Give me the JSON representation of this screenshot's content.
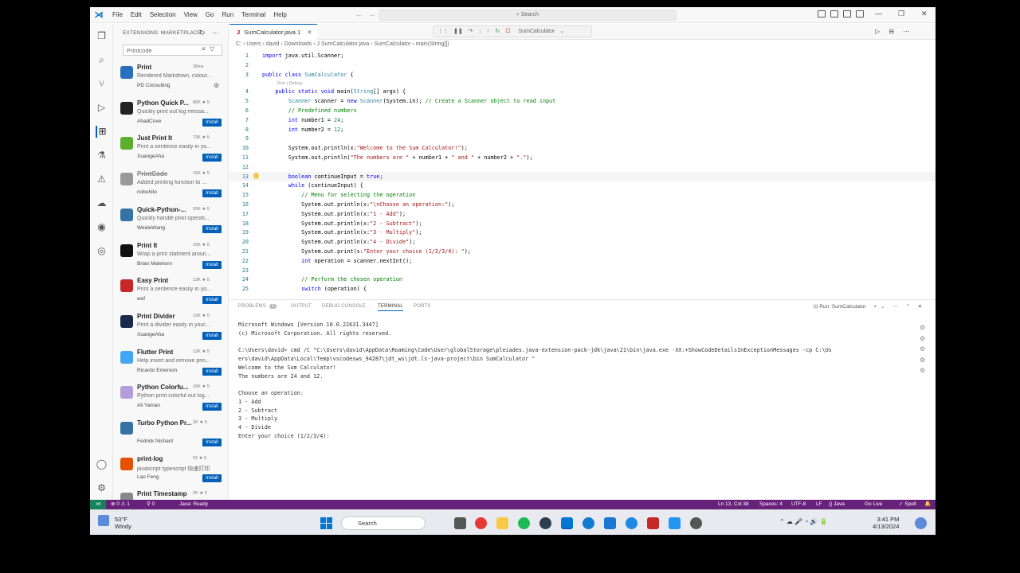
{
  "menu": [
    "File",
    "Edit",
    "Selection",
    "View",
    "Go",
    "Run",
    "Terminal",
    "Help"
  ],
  "command_center": "Search",
  "sidebar": {
    "title": "EXTENSIONS: MARKETPLACE",
    "search_value": "Printcode",
    "extensions": [
      {
        "name": "Print",
        "stats": "38ms",
        "desc": "Rendered Markdown, colour...",
        "publisher": "PD Consulting",
        "action": "gear",
        "color": "#2a6fbf"
      },
      {
        "name": "Python Quick P...",
        "stats": "80K ★ 5",
        "desc": "Quickly print out log messa...",
        "publisher": "AhadCove",
        "action": "Install",
        "color": "#222"
      },
      {
        "name": "Just Print It",
        "stats": "73K ★ 5",
        "desc": "Print a sentence easily in yo...",
        "publisher": "XuangeAha",
        "action": "Install",
        "color": "#5ab02e"
      },
      {
        "name": "PrintCode",
        "stats": "15K ★ 5",
        "desc": "Added printing function to ...",
        "publisher": "nobuhito",
        "action": "Install",
        "color": "#999"
      },
      {
        "name": "Quick-Python-...",
        "stats": "20K ★ 5",
        "desc": "Quickly handle print operati...",
        "publisher": "WeideWang",
        "action": "Install",
        "color": "#3572A5"
      },
      {
        "name": "Print It",
        "stats": "15K ★ 5",
        "desc": "Wrap a print statment aroun...",
        "publisher": "Brian Malehorn",
        "action": "Install",
        "color": "#111"
      },
      {
        "name": "Easy Print",
        "stats": "13K ★ 5",
        "desc": "Print a sentence easily in yo...",
        "publisher": "wof",
        "action": "Install",
        "color": "#c62828"
      },
      {
        "name": "Print Divider",
        "stats": "12K ★ 5",
        "desc": "Print a divider easily in your...",
        "publisher": "XuangeAha",
        "action": "Install",
        "color": "#1a2a4a"
      },
      {
        "name": "Flutter Print",
        "stats": "13K ★ 5",
        "desc": "Help insert and remove prin...",
        "publisher": "Ricardo Emerson",
        "action": "Install",
        "color": "#42a5f5"
      },
      {
        "name": "Python Colorfu...",
        "stats": "16K ★ 5",
        "desc": "Python print colorful out log...",
        "publisher": "Ali Yaman",
        "action": "Install",
        "color": "#b39ddb"
      },
      {
        "name": "Turbo Python Pr...",
        "stats": "2K ★ 5",
        "desc": "",
        "publisher": "Fedrick Nishant",
        "action": "Install",
        "color": "#3572A5"
      },
      {
        "name": "print-log",
        "stats": "52 ★ 5",
        "desc": "javascript typescript 快速打印",
        "publisher": "Lao Feng",
        "action": "Install",
        "color": "#e65100"
      },
      {
        "name": "Print Timestamp",
        "stats": "2K ★ 5",
        "desc": "",
        "publisher": "",
        "action": "",
        "color": "#888"
      }
    ]
  },
  "editor": {
    "tab": "SumCalculator.java 1",
    "debug_config": "SumCalculator",
    "breadcrumb": "C: › Users › david › Downloads › J SumCalculator.java › SumCalculator › main(String[])",
    "codelens": "Run | Debug"
  },
  "panel": {
    "tabs": [
      "PROBLEMS",
      "OUTPUT",
      "DEBUG CONSOLE",
      "TERMINAL",
      "PORTS"
    ],
    "problems_count": "1",
    "run_label": "Run: SumCalculator",
    "terminal_lines": [
      "Microsoft Windows [Version 10.0.22631.3447]",
      "(c) Microsoft Corporation. All rights reserved.",
      "",
      "C:\\Users\\david> cmd /C \"C:\\Users\\david\\AppData\\Roaming\\Code\\User\\globalStorage\\pleiades.java-extension-pack-jdk\\java\\21\\bin\\java.exe -XX:+ShowCodeDetailsInExceptionMessages -cp C:\\Us",
      "ers\\david\\AppData\\Local\\Temp\\vscodesws_94287\\jdt_ws\\jdt.ls-java-project\\bin SumCalculator \"",
      "Welcome to the Sum Calculator!",
      "The numbers are 24 and 12.",
      "",
      "Choose an operation:",
      "1 - Add",
      "2 - Subtract",
      "3 - Multiply",
      "4 - Divide",
      "Enter your choice (1/2/3/4):"
    ]
  },
  "statusbar": {
    "problems": "⊗ 0 ⚠ 1",
    "ports": "⚲ 0",
    "java": "Java: Ready",
    "position": "Ln 13, Col 38",
    "spaces": "Spaces: 4",
    "encoding": "UTF-8",
    "eol": "LF",
    "language": "{} Java",
    "golive": "Go Live",
    "spell": "✓ Spell"
  },
  "taskbar": {
    "temp": "53°F",
    "weather": "Windy",
    "search": "Search",
    "time": "3:41 PM",
    "date": "4/13/2024"
  },
  "colors": {
    "accent": "#005fb8",
    "statusbar": "#68217a",
    "remote": "#16825d"
  }
}
